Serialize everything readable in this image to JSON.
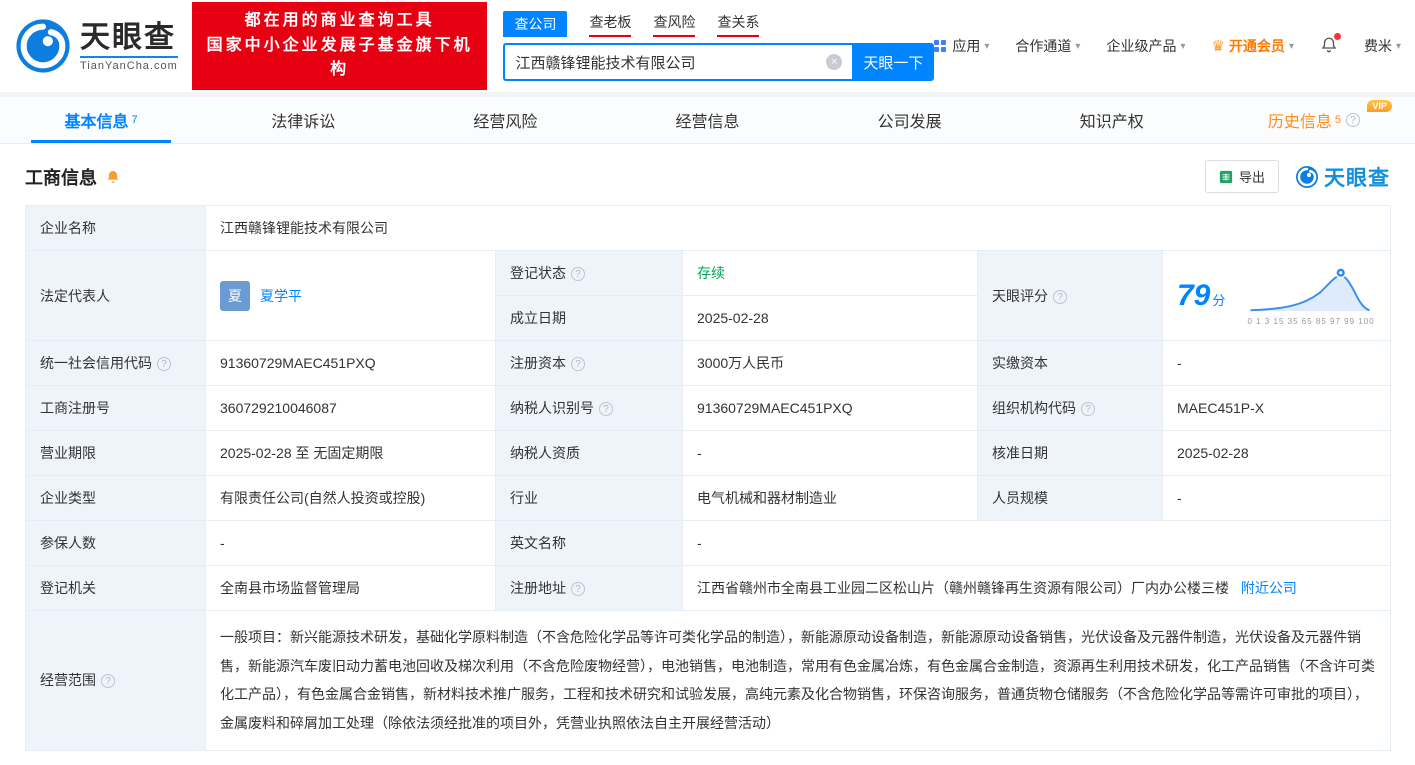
{
  "colors": {
    "brand_blue": "#0084ff",
    "brand_red": "#e60012",
    "status_green": "#00a854",
    "vip_orange": "#ff8c19"
  },
  "icons": {
    "clear": "×",
    "chevron": "▾",
    "help": "?",
    "crown": "♛"
  },
  "header": {
    "logo": {
      "brand": "天眼查",
      "domain": "TianYanCha.com"
    },
    "slogan": {
      "line1": "都在用的商业查询工具",
      "line2": "国家中小企业发展子基金旗下机构"
    },
    "search_tabs": [
      {
        "label": "查公司"
      },
      {
        "label": "查老板"
      },
      {
        "label": "查风险"
      },
      {
        "label": "查关系"
      }
    ],
    "search": {
      "value": "江西赣锋锂能技术有限公司",
      "button": "天眼一下"
    },
    "nav": {
      "apps": "应用",
      "cooperation": "合作通道",
      "enterprise": "企业级产品",
      "vip": "开通会员",
      "user": "费米"
    }
  },
  "tabs": [
    {
      "label": "基本信息",
      "badge": "7"
    },
    {
      "label": "法律诉讼",
      "badge": ""
    },
    {
      "label": "经营风险",
      "badge": ""
    },
    {
      "label": "经营信息",
      "badge": ""
    },
    {
      "label": "公司发展",
      "badge": ""
    },
    {
      "label": "知识产权",
      "badge": ""
    },
    {
      "label": "历史信息",
      "badge": "5",
      "vip_tag": "VIP"
    }
  ],
  "section": {
    "title": "工商信息",
    "export": "导出",
    "watermark": "天眼查"
  },
  "info": {
    "company_name": {
      "label": "企业名称",
      "value": "江西赣锋锂能技术有限公司"
    },
    "legal_rep": {
      "label": "法定代表人",
      "avatar": "夏",
      "name": "夏学平"
    },
    "reg_status": {
      "label": "登记状态",
      "value": "存续"
    },
    "score": {
      "label": "天眼评分",
      "value": "79",
      "unit": "分",
      "axis": "0 1 3 15 35 65 85 97 99 100"
    },
    "establish_date": {
      "label": "成立日期",
      "value": "2025-02-28"
    },
    "credit_code": {
      "label": "统一社会信用代码",
      "value": "91360729MAEC451PXQ"
    },
    "reg_capital": {
      "label": "注册资本",
      "value": "3000万人民币"
    },
    "paid_capital": {
      "label": "实缴资本",
      "value": "-"
    },
    "reg_number": {
      "label": "工商注册号",
      "value": "360729210046087"
    },
    "taxpayer_id": {
      "label": "纳税人识别号",
      "value": "91360729MAEC451PXQ"
    },
    "org_code": {
      "label": "组织机构代码",
      "value": "MAEC451P-X"
    },
    "business_term": {
      "label": "营业期限",
      "value": "2025-02-28 至 无固定期限"
    },
    "taxpayer_qualification": {
      "label": "纳税人资质",
      "value": "-"
    },
    "approval_date": {
      "label": "核准日期",
      "value": "2025-02-28"
    },
    "company_type": {
      "label": "企业类型",
      "value": "有限责任公司(自然人投资或控股)"
    },
    "industry": {
      "label": "行业",
      "value": "电气机械和器材制造业"
    },
    "staff_size": {
      "label": "人员规模",
      "value": "-"
    },
    "insured_count": {
      "label": "参保人数",
      "value": "-"
    },
    "english_name": {
      "label": "英文名称",
      "value": "-"
    },
    "reg_authority": {
      "label": "登记机关",
      "value": "全南县市场监督管理局"
    },
    "reg_address": {
      "label": "注册地址",
      "value": "江西省赣州市全南县工业园二区松山片（赣州赣锋再生资源有限公司）厂内办公楼三楼",
      "link": "附近公司"
    },
    "business_scope": {
      "label": "经营范围",
      "value": "一般项目：新兴能源技术研发，基础化学原料制造（不含危险化学品等许可类化学品的制造），新能源原动设备制造，新能源原动设备销售，光伏设备及元器件制造，光伏设备及元器件销售，新能源汽车废旧动力蓄电池回收及梯次利用（不含危险废物经营），电池销售，电池制造，常用有色金属冶炼，有色金属合金制造，资源再生利用技术研发，化工产品销售（不含许可类化工产品），有色金属合金销售，新材料技术推广服务，工程和技术研究和试验发展，高纯元素及化合物销售，环保咨询服务，普通货物仓储服务（不含危险化学品等需许可审批的项目），金属废料和碎屑加工处理（除依法须经批准的项目外，凭营业执照依法自主开展经营活动）"
    }
  }
}
